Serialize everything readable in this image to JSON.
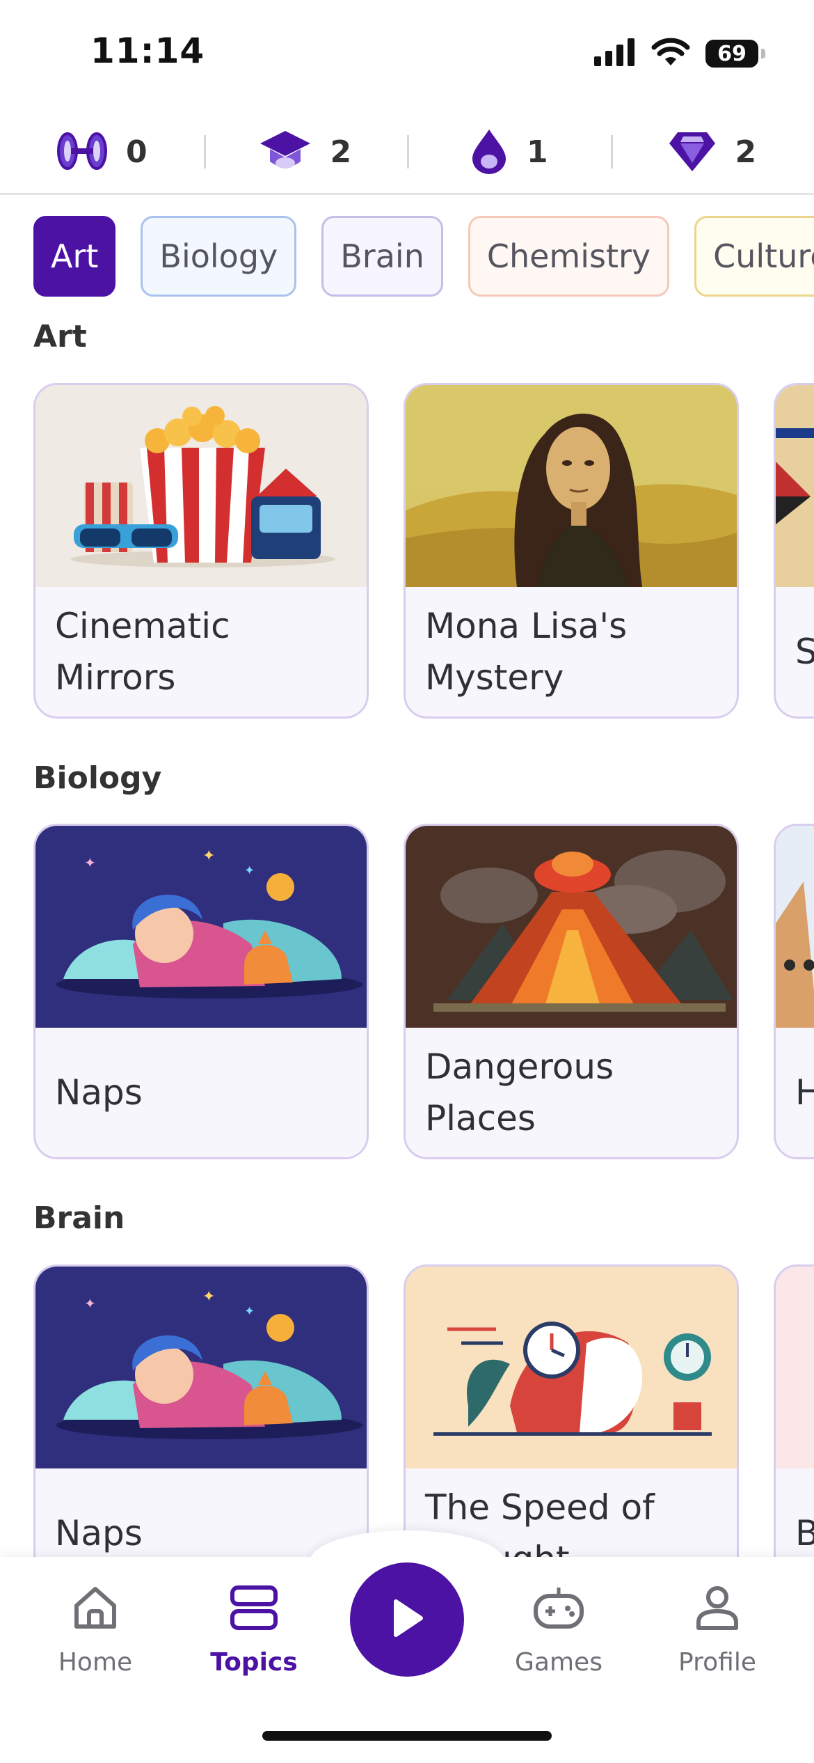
{
  "status_bar": {
    "time": "11:14",
    "battery": "69"
  },
  "stats": [
    {
      "icon": "streak-icon",
      "value": "0"
    },
    {
      "icon": "graduation-cap-icon",
      "value": "2"
    },
    {
      "icon": "drop-icon",
      "value": "1"
    },
    {
      "icon": "diamond-icon",
      "value": "2"
    }
  ],
  "chips": [
    {
      "label": "Art",
      "border": "#4b12a4",
      "bg": "#4b12a4"
    },
    {
      "label": "Biology",
      "border": "#a9c3ee",
      "bg": "#f3f7fe"
    },
    {
      "label": "Brain",
      "border": "#c8bde9",
      "bg": "#f7f5fd"
    },
    {
      "label": "Chemistry",
      "border": "#f4c9b8",
      "bg": "#fff7f3"
    },
    {
      "label": "Culture",
      "border": "#ecd58a",
      "bg": "#fffcf0"
    }
  ],
  "sections": [
    {
      "title": "Art",
      "cards": [
        {
          "title": "Cinematic Mirrors",
          "image": "popcorn-image"
        },
        {
          "title": "Mona Lisa's Mystery",
          "image": "mona-lisa-image"
        },
        {
          "title": "S R",
          "image": "art-peek-image"
        }
      ]
    },
    {
      "title": "Biology",
      "cards": [
        {
          "title": "Naps",
          "image": "sleeping-child-image"
        },
        {
          "title": "Dangerous Places",
          "image": "volcano-image"
        },
        {
          "title": "H",
          "image": "biology-peek-image"
        }
      ]
    },
    {
      "title": "Brain",
      "cards": [
        {
          "title": "Naps",
          "image": "sleeping-child-image"
        },
        {
          "title": "The Speed of Thought",
          "image": "speed-thought-image"
        },
        {
          "title": "B",
          "image": "brain-peek-image"
        }
      ]
    }
  ],
  "nav": {
    "items": [
      {
        "label": "Home",
        "icon": "home-icon"
      },
      {
        "label": "Topics",
        "icon": "topics-icon"
      },
      {
        "label": "Games",
        "icon": "gamepad-icon"
      },
      {
        "label": "Profile",
        "icon": "profile-icon"
      }
    ],
    "play_icon": "play-icon"
  },
  "colors": {
    "accent": "#4b12a4",
    "card_border": "#d9cdee",
    "card_bg": "#f8f6fd"
  }
}
